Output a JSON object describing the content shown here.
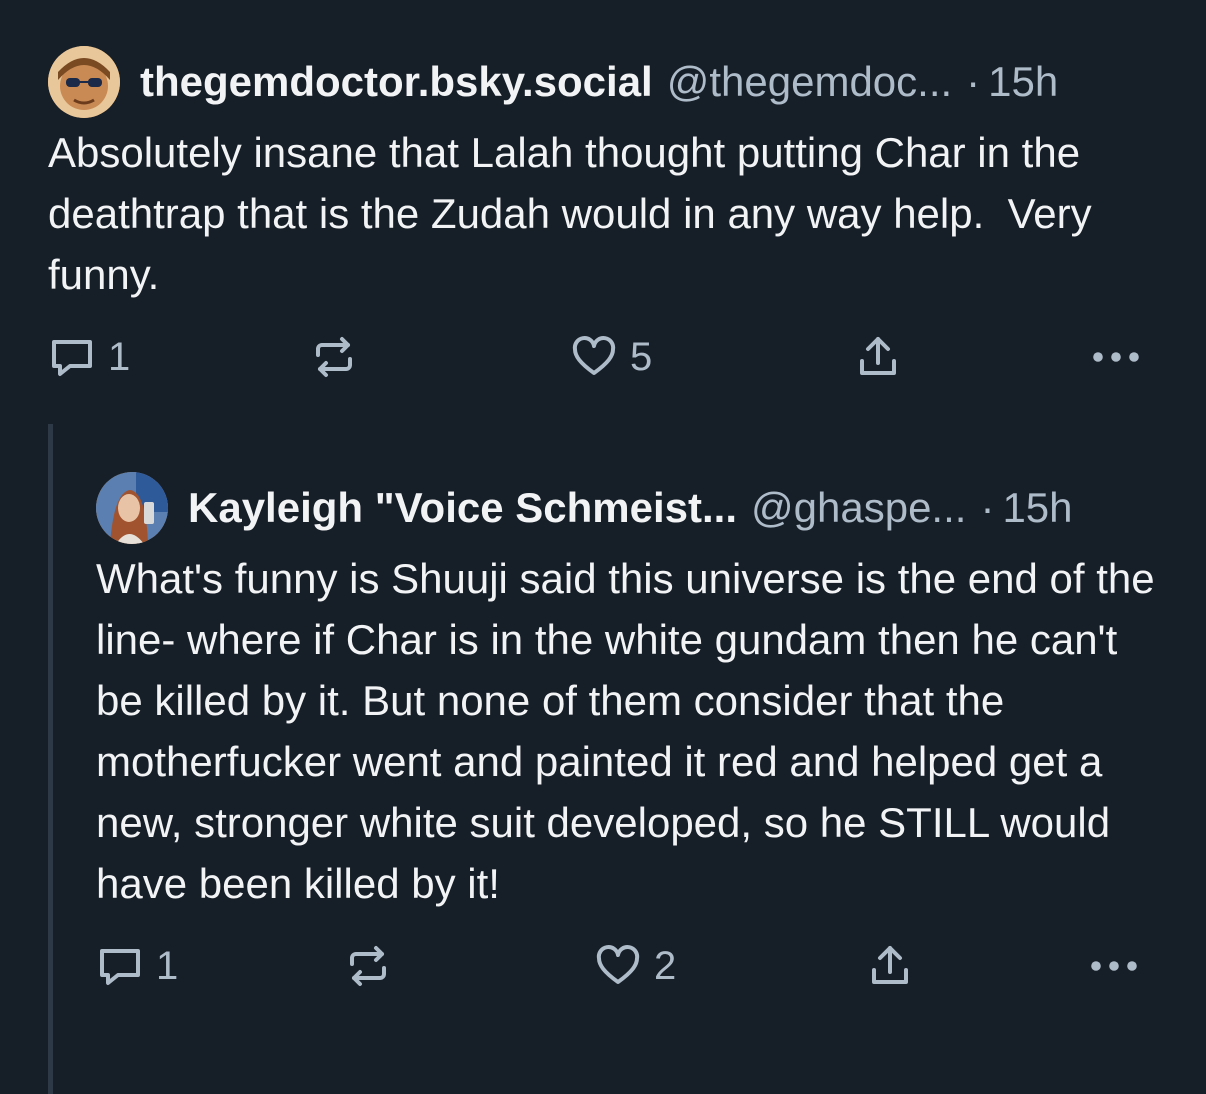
{
  "posts": [
    {
      "display_name": "thegemdoctor.bsky.social",
      "handle": "@thegemdoc...",
      "separator": "·",
      "time": "15h",
      "text": "Absolutely insane that Lalah thought putting Char in the deathtrap that is the Zudah would in any way help.  Very funny.",
      "actions": {
        "reply_count": "1",
        "repost_count": "",
        "like_count": "5"
      },
      "icons": [
        "reply-icon",
        "repost-icon",
        "like-icon",
        "share-icon",
        "more-icon"
      ]
    },
    {
      "display_name": "Kayleigh \"Voice Schmeist...",
      "handle": "@ghaspe...",
      "separator": "·",
      "time": "15h",
      "text": "What's funny is Shuuji said this universe is the end of the line- where if Char is in the white gundam then he can't be killed by it. But none of them consider that the motherfucker went and painted it red and helped get a new, stronger white suit developed, so he STILL would have been killed by it!",
      "actions": {
        "reply_count": "1",
        "repost_count": "",
        "like_count": "2"
      },
      "icons": [
        "reply-icon",
        "repost-icon",
        "like-icon",
        "share-icon",
        "more-icon"
      ]
    }
  ],
  "colors": {
    "background": "#161e27",
    "text": "#f1f3f5",
    "muted": "#aebbc9",
    "thread_line": "#2d3946"
  }
}
